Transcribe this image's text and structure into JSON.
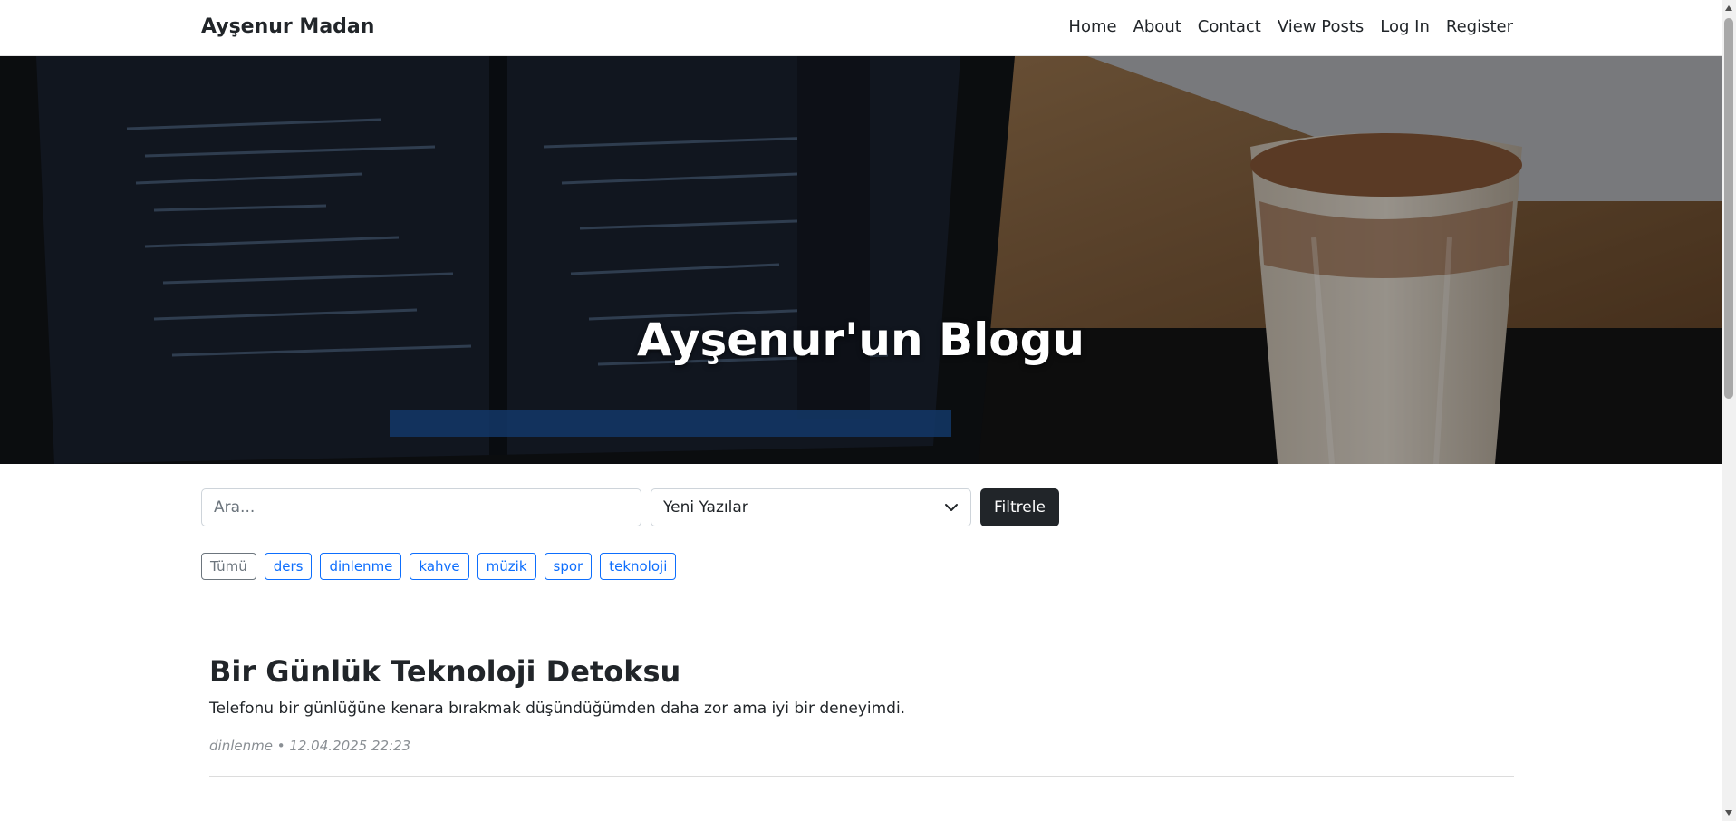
{
  "navbar": {
    "brand": "Ayşenur Madan",
    "links": [
      "Home",
      "About",
      "Contact",
      "View Posts",
      "Log In",
      "Register"
    ]
  },
  "hero": {
    "title": "Ayşenur'un Blogu"
  },
  "filters": {
    "search_placeholder": "Ara...",
    "sort_selected": "Yeni Yazılar",
    "filter_button": "Filtrele"
  },
  "tags": [
    "Tümü",
    "ders",
    "dinlenme",
    "kahve",
    "müzik",
    "spor",
    "teknoloji"
  ],
  "posts": [
    {
      "title": "Bir Günlük Teknoloji Detoksu",
      "excerpt": "Telefonu bir günlüğüne kenara bırakmak düşündüğümden daha zor ama iyi bir deneyimdi.",
      "meta": "dinlenme • 12.04.2025 22:23"
    }
  ],
  "colors": {
    "primary": "#0d6efd",
    "dark": "#212529",
    "muted": "#6c757d"
  }
}
